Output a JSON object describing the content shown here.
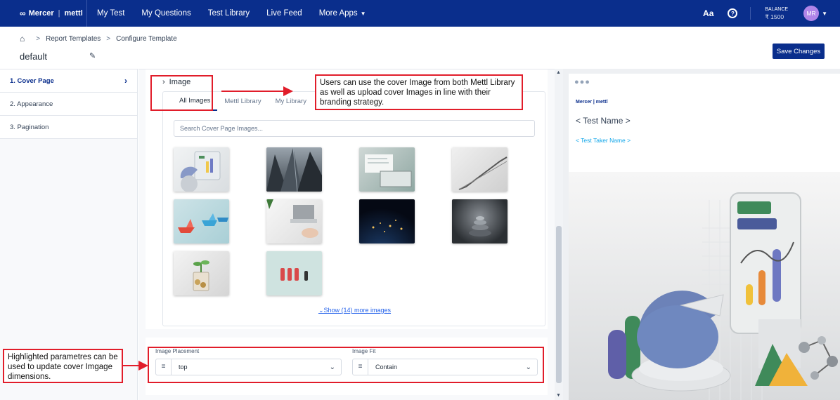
{
  "nav": {
    "brand": "Mercer",
    "brand_sub": "mettl",
    "links": [
      "My Test",
      "My Questions",
      "Test Library",
      "Live Feed",
      "More Apps"
    ],
    "text_size_label": "Aa",
    "help_label": "?",
    "balance_label": "BALANCE",
    "balance_amount": "₹ 1500",
    "avatar_initials": "MR"
  },
  "breadcrumb": {
    "items": [
      "Report Templates",
      "Configure Template"
    ]
  },
  "template": {
    "name": "default",
    "save_label": "Save Changes"
  },
  "sidebar": {
    "items": [
      {
        "label": "1. Cover Page",
        "active": true
      },
      {
        "label": "2. Appearance",
        "active": false
      },
      {
        "label": "3. Pagination",
        "active": false
      }
    ]
  },
  "image_section": {
    "title": "Image",
    "tabs": [
      "All Images",
      "Mettl Library",
      "My Library"
    ],
    "search_placeholder": "Search Cover Page Images...",
    "more_link": "Show (14) more images",
    "thumbnails": [
      "desk-chart-icon",
      "skyscrapers-icon",
      "laptop-paper-icon",
      "staircase-icon",
      "paper-boats-icon",
      "laptop-hand-icon",
      "earth-night-icon",
      "stacked-stones-icon",
      "coin-plant-icon",
      "figurines-icon"
    ]
  },
  "placement": {
    "placement_label": "Image Placement",
    "placement_value": "top",
    "fit_label": "Image Fit",
    "fit_value": "Contain"
  },
  "preview": {
    "dots": "●●●",
    "brand": "Mercer | mettl",
    "test_name": "< Test Name >",
    "taker_name": "< Test Taker Name >"
  },
  "annotations": {
    "top_note": "Users can use the cover Image from both Mettl Library as well as upload cover Images in line with their branding strategy.",
    "left_note": "Highlighted parametres can be used to update cover Imgage dimensions."
  },
  "colors": {
    "nav_bg": "#0a2e8c",
    "accent": "#0a2e8c",
    "annotation": "#e11d2a"
  }
}
